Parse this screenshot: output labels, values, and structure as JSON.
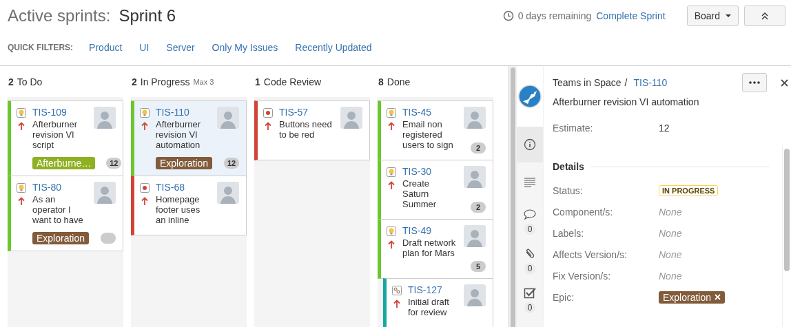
{
  "header": {
    "title": "Active sprints:",
    "sprint": "Sprint 6",
    "remaining": "0 days remaining",
    "complete_sprint": "Complete Sprint",
    "board_button": "Board"
  },
  "quick_filters": {
    "label": "QUICK FILTERS:",
    "items": [
      "Product",
      "UI",
      "Server",
      "Only My Issues",
      "Recently Updated"
    ]
  },
  "columns": [
    {
      "count": "2",
      "name": "To Do",
      "cards": [
        {
          "kind": "story",
          "key": "TIS-109",
          "summary": "Afterburner revision VI script",
          "color": "#6bc72f",
          "selected": false,
          "epic": {
            "label": "Afterburne…",
            "color": "#8eb021"
          },
          "estimate": "12",
          "empty_badge": false
        },
        {
          "kind": "story",
          "key": "TIS-80",
          "summary": "As an operator I want to have",
          "color": "#6bc72f",
          "selected": false,
          "epic": {
            "label": "Exploration",
            "color": "#815b3a"
          },
          "empty_badge": true
        }
      ]
    },
    {
      "count": "2",
      "name": "In Progress",
      "limit": "Max 3",
      "cards": [
        {
          "kind": "story",
          "key": "TIS-110",
          "summary": "Afterburner revision VI automation",
          "color": "#6bc72f",
          "selected": true,
          "epic": {
            "label": "Exploration",
            "color": "#815b3a"
          },
          "estimate": "12",
          "empty_badge": false
        },
        {
          "kind": "bug",
          "key": "TIS-68",
          "summary": "Homepage footer uses an inline",
          "color": "#d04437",
          "selected": false,
          "empty_badge": false
        }
      ]
    },
    {
      "count": "1",
      "name": "Code Review",
      "cards": [
        {
          "kind": "bug",
          "key": "TIS-57",
          "summary": "Buttons need to be red",
          "color": "#d04437",
          "selected": false,
          "empty_badge": false
        }
      ]
    },
    {
      "count": "8",
      "name": "Done",
      "cards": [
        {
          "kind": "story",
          "key": "TIS-45",
          "summary": "Email non registered users to sign",
          "color": "#6bc72f",
          "selected": false,
          "estimate": "2",
          "empty_badge": false
        },
        {
          "kind": "story",
          "key": "TIS-30",
          "summary": "Create Saturn Summer",
          "color": "#6bc72f",
          "selected": false,
          "estimate": "2",
          "empty_badge": false
        },
        {
          "kind": "story",
          "key": "TIS-49",
          "summary": "Draft network plan for Mars",
          "color": "#6bc72f",
          "selected": false,
          "estimate": "5",
          "empty_badge": false
        },
        {
          "kind": "subtask",
          "key": "TIS-127",
          "summary": "Initial draft for review",
          "color": "#14a99f",
          "selected": false,
          "empty_badge": false
        }
      ]
    }
  ],
  "detail": {
    "project": "Teams in Space",
    "separator": "/",
    "key": "TIS-110",
    "summary": "Afterburner revision VI automation",
    "estimate_label": "Estimate:",
    "estimate": "12",
    "tabs": [
      {
        "kind": "info",
        "selected": true
      },
      {
        "kind": "description",
        "selected": false
      },
      {
        "kind": "comments",
        "count": "0",
        "selected": false
      },
      {
        "kind": "attachments",
        "count": "0",
        "selected": false
      },
      {
        "kind": "checklist",
        "count": "0",
        "selected": false
      }
    ],
    "details_heading": "Details",
    "fields": [
      {
        "label": "Status:",
        "kind": "status",
        "value": "IN PROGRESS"
      },
      {
        "label": "Component/s:",
        "kind": "none",
        "value": "None"
      },
      {
        "label": "Labels:",
        "kind": "none",
        "value": "None"
      },
      {
        "label": "Affects Version/s:",
        "kind": "none",
        "value": "None"
      },
      {
        "label": "Fix Version/s:",
        "kind": "none",
        "value": "None"
      },
      {
        "label": "Epic:",
        "kind": "epic",
        "value": "Exploration",
        "color": "#815b3a"
      }
    ]
  }
}
